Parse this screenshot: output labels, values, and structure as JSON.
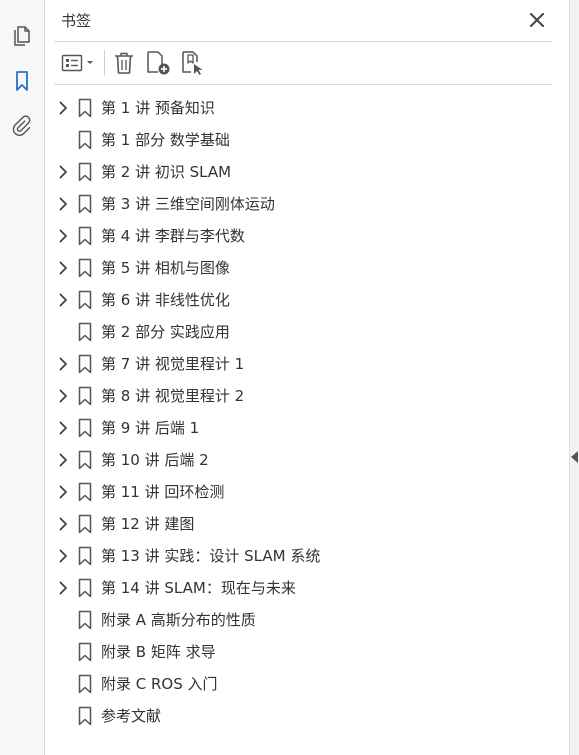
{
  "panel": {
    "title": "书签"
  },
  "colors": {
    "accent": "#2b72c2",
    "icon": "#555555"
  },
  "icons": {
    "rail": [
      "pages-icon",
      "bookmark-icon",
      "attachment-icon"
    ],
    "toolbar": [
      "options-menu-icon",
      "delete-icon",
      "new-bookmark-icon",
      "bookmark-from-structure-icon"
    ],
    "close": "close-icon",
    "splitter": "chevron-left-icon"
  },
  "bookmarks": [
    {
      "label": "第 1 讲 预备知识",
      "expandable": true
    },
    {
      "label": "第 1 部分 数学基础",
      "expandable": false
    },
    {
      "label": "第 2 讲 初识 SLAM",
      "expandable": true
    },
    {
      "label": "第 3 讲 三维空间刚体运动",
      "expandable": true
    },
    {
      "label": "第 4 讲 李群与李代数",
      "expandable": true
    },
    {
      "label": "第 5 讲 相机与图像",
      "expandable": true
    },
    {
      "label": "第 6 讲 非线性优化",
      "expandable": true
    },
    {
      "label": "第 2 部分 实践应用",
      "expandable": false
    },
    {
      "label": "第 7 讲 视觉里程计 1",
      "expandable": true
    },
    {
      "label": "第 8 讲 视觉里程计 2",
      "expandable": true
    },
    {
      "label": "第 9 讲 后端 1",
      "expandable": true
    },
    {
      "label": "第 10 讲 后端 2",
      "expandable": true
    },
    {
      "label": "第 11 讲 回环检测",
      "expandable": true
    },
    {
      "label": "第 12 讲 建图",
      "expandable": true
    },
    {
      "label": "第 13 讲 实践：设计 SLAM 系统",
      "expandable": true
    },
    {
      "label": "第 14 讲 SLAM：现在与未来",
      "expandable": true
    },
    {
      "label": "附录 A 高斯分布的性质",
      "expandable": false
    },
    {
      "label": "附录 B 矩阵 求导",
      "expandable": false
    },
    {
      "label": "附录 C ROS 入门",
      "expandable": false
    },
    {
      "label": "参考文献",
      "expandable": false
    }
  ]
}
